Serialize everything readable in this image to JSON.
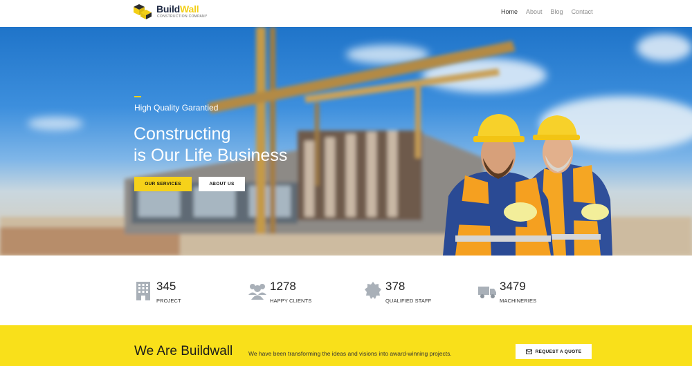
{
  "header": {
    "logo": {
      "name_part1": "Build",
      "name_part2": "Wall",
      "tagline": "CONSTRUCTION COMPANY"
    },
    "nav": [
      {
        "label": "Home",
        "active": true
      },
      {
        "label": "About",
        "active": false
      },
      {
        "label": "Blog",
        "active": false
      },
      {
        "label": "Contact",
        "active": false
      }
    ]
  },
  "hero": {
    "eyebrow": "High Quality Garantied",
    "title_line1": "Constructing",
    "title_line2": "is Our Life Business",
    "primary_button": "OUR SERVICES",
    "secondary_button": "ABOUT US"
  },
  "stats": [
    {
      "icon": "building-icon",
      "value": "345",
      "label": "PROJECT"
    },
    {
      "icon": "users-icon",
      "value": "1278",
      "label": "HAPPY CLIENTS"
    },
    {
      "icon": "badge-icon",
      "value": "378",
      "label": "QUALIFIED STAFF"
    },
    {
      "icon": "truck-icon",
      "value": "3479",
      "label": "MACHINERIES"
    }
  ],
  "band": {
    "title": "We Are Buildwall",
    "text": "We have been transforming the ideas and visions into award-winning projects.",
    "button": "REQUEST A QUOTE",
    "button_icon": "envelope-icon"
  },
  "colors": {
    "accent": "#f6d21a",
    "band": "#f9e01a",
    "dark": "#1f2a44"
  }
}
